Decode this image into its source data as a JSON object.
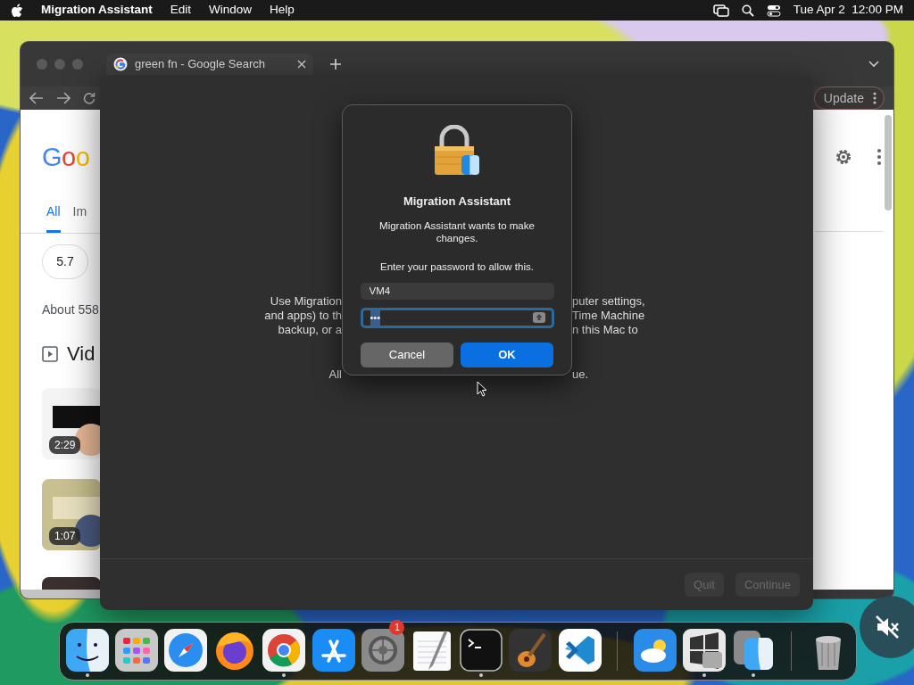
{
  "menu_bar": {
    "app": "Migration Assistant",
    "menus": [
      "Edit",
      "Window",
      "Help"
    ],
    "clock": "Tue Apr 2  12:00 PM"
  },
  "browser": {
    "tab": {
      "title": "green fn - Google Search",
      "selected": true
    },
    "update_button": "Update",
    "page": {
      "logo": "Goo",
      "tabs": [
        {
          "label": "All",
          "selected": true
        },
        {
          "label": "Im",
          "selected": false
        }
      ],
      "chip": "5.7",
      "result_count": "About 558",
      "section": "Vid",
      "videos": [
        {
          "duration": "2:29"
        },
        {
          "duration": "1:07"
        },
        {
          "kind": "picture"
        }
      ]
    }
  },
  "migration_window": {
    "intro_left": [
      "Use Migration",
      "and apps) to th",
      "backup, or a"
    ],
    "intro_right": [
      "puter settings,",
      "Time Machine",
      "n this Mac to"
    ],
    "note_left": "All",
    "note_right": "ue.",
    "buttons": [
      {
        "label": "Quit",
        "disabled": true
      },
      {
        "label": "Continue",
        "disabled": true
      }
    ]
  },
  "auth_dialog": {
    "title": "Migration Assistant",
    "message": "Migration Assistant wants to make changes.",
    "prompt": "Enter your password to allow this.",
    "username": "VM4",
    "password": "•••",
    "buttons": [
      {
        "label": "Cancel",
        "kind": "secondary"
      },
      {
        "label": "OK",
        "kind": "default"
      }
    ]
  },
  "dock": {
    "apps": [
      {
        "kind": "finder",
        "running": true
      },
      {
        "kind": "launchpad",
        "running": false
      },
      {
        "kind": "safari",
        "running": false
      },
      {
        "kind": "firefox",
        "running": false
      },
      {
        "kind": "chrome",
        "running": true
      },
      {
        "kind": "appstore",
        "running": false
      },
      {
        "kind": "settings",
        "running": false,
        "badge": "1"
      },
      {
        "kind": "textedit",
        "running": false
      },
      {
        "kind": "terminal",
        "running": true
      },
      {
        "kind": "garageband",
        "running": false
      },
      {
        "kind": "vscode",
        "running": false
      },
      {
        "kind": "separator"
      },
      {
        "kind": "weather",
        "running": false
      },
      {
        "kind": "bootcamp",
        "running": true
      },
      {
        "kind": "migration",
        "running": true
      },
      {
        "kind": "separator"
      },
      {
        "kind": "trash",
        "running": false
      }
    ]
  }
}
